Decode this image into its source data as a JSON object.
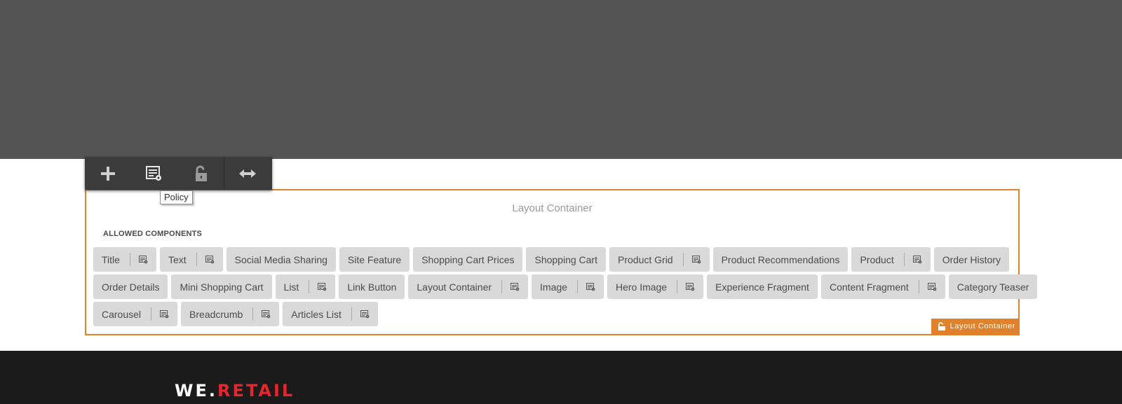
{
  "toolbar": {
    "buttons": [
      {
        "name": "add-icon"
      },
      {
        "name": "policy-icon"
      },
      {
        "name": "unlock-icon"
      },
      {
        "name": "resize-icon"
      }
    ],
    "tooltip": "Policy"
  },
  "container": {
    "label": "Layout Container",
    "allowed_heading": "ALLOWED COMPONENTS",
    "corner_label": "Layout Container",
    "accent_color": "#e0822b"
  },
  "components": {
    "rows": [
      [
        {
          "label": "Title",
          "policy": true
        },
        {
          "label": "Text",
          "policy": true
        },
        {
          "label": "Social Media Sharing",
          "policy": false
        },
        {
          "label": "Site Feature",
          "policy": false
        },
        {
          "label": "Shopping Cart Prices",
          "policy": false
        },
        {
          "label": "Shopping Cart",
          "policy": false
        },
        {
          "label": "Product Grid",
          "policy": true
        },
        {
          "label": "Product Recommendations",
          "policy": false
        },
        {
          "label": "Product",
          "policy": true
        },
        {
          "label": "Order History",
          "policy": false
        }
      ],
      [
        {
          "label": "Order Details",
          "policy": false
        },
        {
          "label": "Mini Shopping Cart",
          "policy": false
        },
        {
          "label": "List",
          "policy": true
        },
        {
          "label": "Link Button",
          "policy": false
        },
        {
          "label": "Layout Container",
          "policy": true
        },
        {
          "label": "Image",
          "policy": true
        },
        {
          "label": "Hero Image",
          "policy": true
        },
        {
          "label": "Experience Fragment",
          "policy": false
        },
        {
          "label": "Content Fragment",
          "policy": true
        },
        {
          "label": "Category Teaser",
          "policy": false
        }
      ],
      [
        {
          "label": "Carousel",
          "policy": true
        },
        {
          "label": "Breadcrumb",
          "policy": true
        },
        {
          "label": "Articles List",
          "policy": true
        }
      ]
    ]
  },
  "footer": {
    "logo_we": "WE",
    "logo_dot": ".",
    "logo_retail": "RETAIL"
  }
}
